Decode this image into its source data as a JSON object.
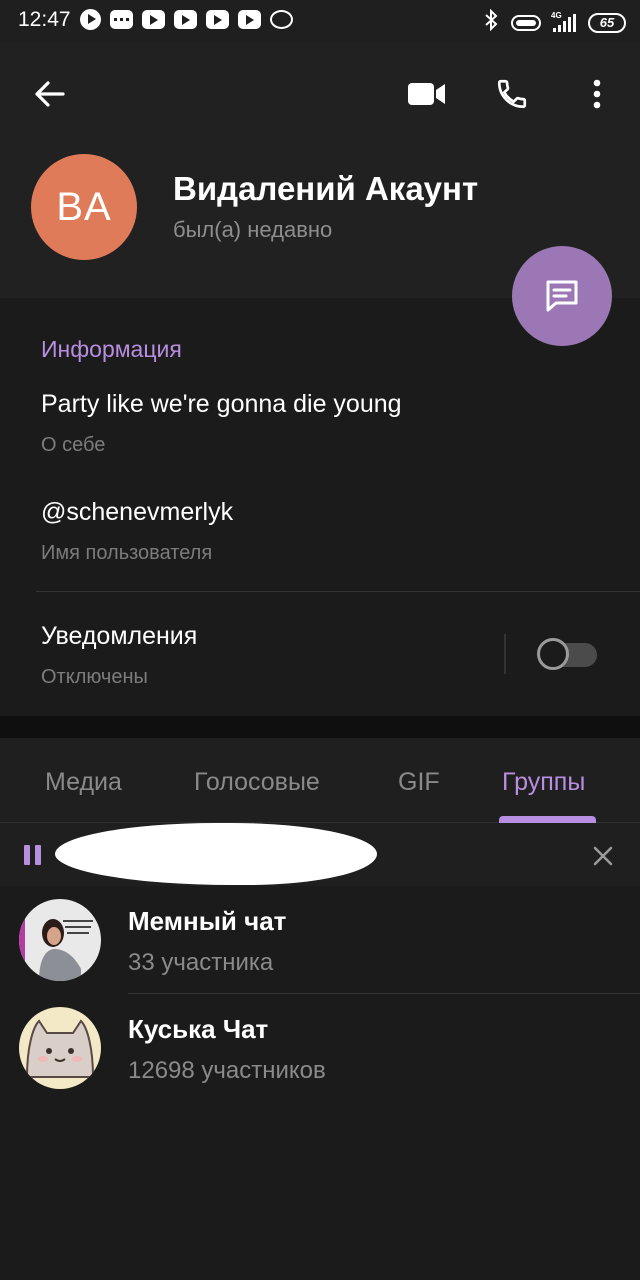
{
  "status_bar": {
    "time": "12:47",
    "network": "4G",
    "battery": "65",
    "icons": [
      "play-circle-icon",
      "message-dots-icon",
      "youtube-icon",
      "youtube-icon",
      "youtube-icon",
      "youtube-icon",
      "viber-icon",
      "bluetooth-icon",
      "vibrate-icon",
      "signal-icon",
      "battery-icon"
    ]
  },
  "header": {
    "back_icon": "arrow-left-icon",
    "actions": [
      "video-call-icon",
      "phone-icon",
      "more-vert-icon"
    ]
  },
  "profile": {
    "initials": "BA",
    "name": "Видалений Акаунт",
    "status": "был(а) недавно",
    "avatar_color": "#e07b5a",
    "fab_icon": "message-icon",
    "fab_color": "#9b78b5"
  },
  "info": {
    "title": "Информация",
    "bio_value": "Party like we're gonna die young",
    "bio_label": "О себе",
    "username_value": "@schenevmerlyk",
    "username_label": "Имя пользователя",
    "notifications_value": "Уведомления",
    "notifications_label": "Отключены",
    "notifications_enabled": false
  },
  "tabs": {
    "items": [
      "Медиа",
      "Голосовые",
      "GIF",
      "Группы"
    ],
    "active": "Группы",
    "accent_color": "#b88ee0"
  },
  "player": {
    "state": "playing",
    "pause_icon": "pause-icon",
    "close_icon": "close-icon"
  },
  "groups": [
    {
      "name": "Мемный чат",
      "members": "33 участника"
    },
    {
      "name": "Куська Чат",
      "members": "12698 участников"
    }
  ]
}
